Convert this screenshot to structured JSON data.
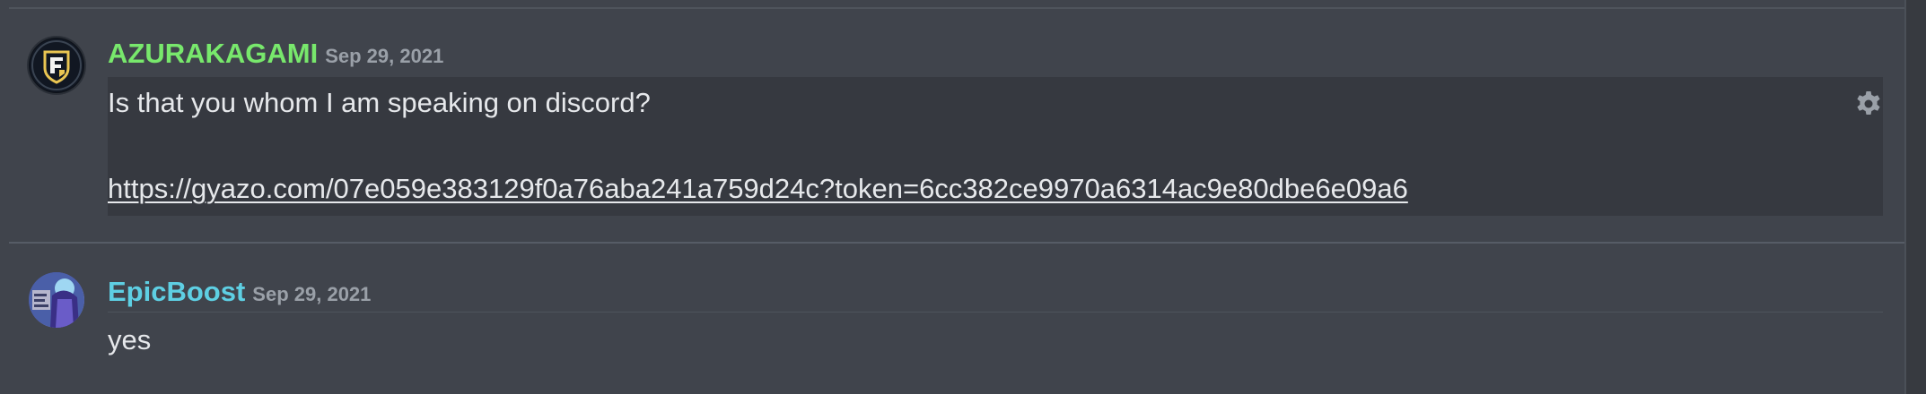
{
  "colors": {
    "background": "#40444c",
    "highlight": "#363940",
    "username_green": "#78e86c",
    "username_teal": "#5ecfe3",
    "timestamp": "#9aa0a8",
    "text": "#e6e8eb"
  },
  "messages": [
    {
      "author": "AZURAKAGAMI",
      "date": "Sep 29, 2021",
      "avatar_icon": "shield-emblem-icon",
      "lines": [
        "Is that you whom I am speaking on discord?"
      ],
      "link": "https://gyazo.com/07e059e383129f0a76aba241a759d24c?token=6cc382ce9970a6314ac9e80dbe6e09a6",
      "action_icon": "gear-icon"
    },
    {
      "author": "EpicBoost",
      "date": "Sep 29, 2021",
      "avatar_icon": "character-portrait-icon",
      "lines": [
        "yes"
      ]
    }
  ]
}
